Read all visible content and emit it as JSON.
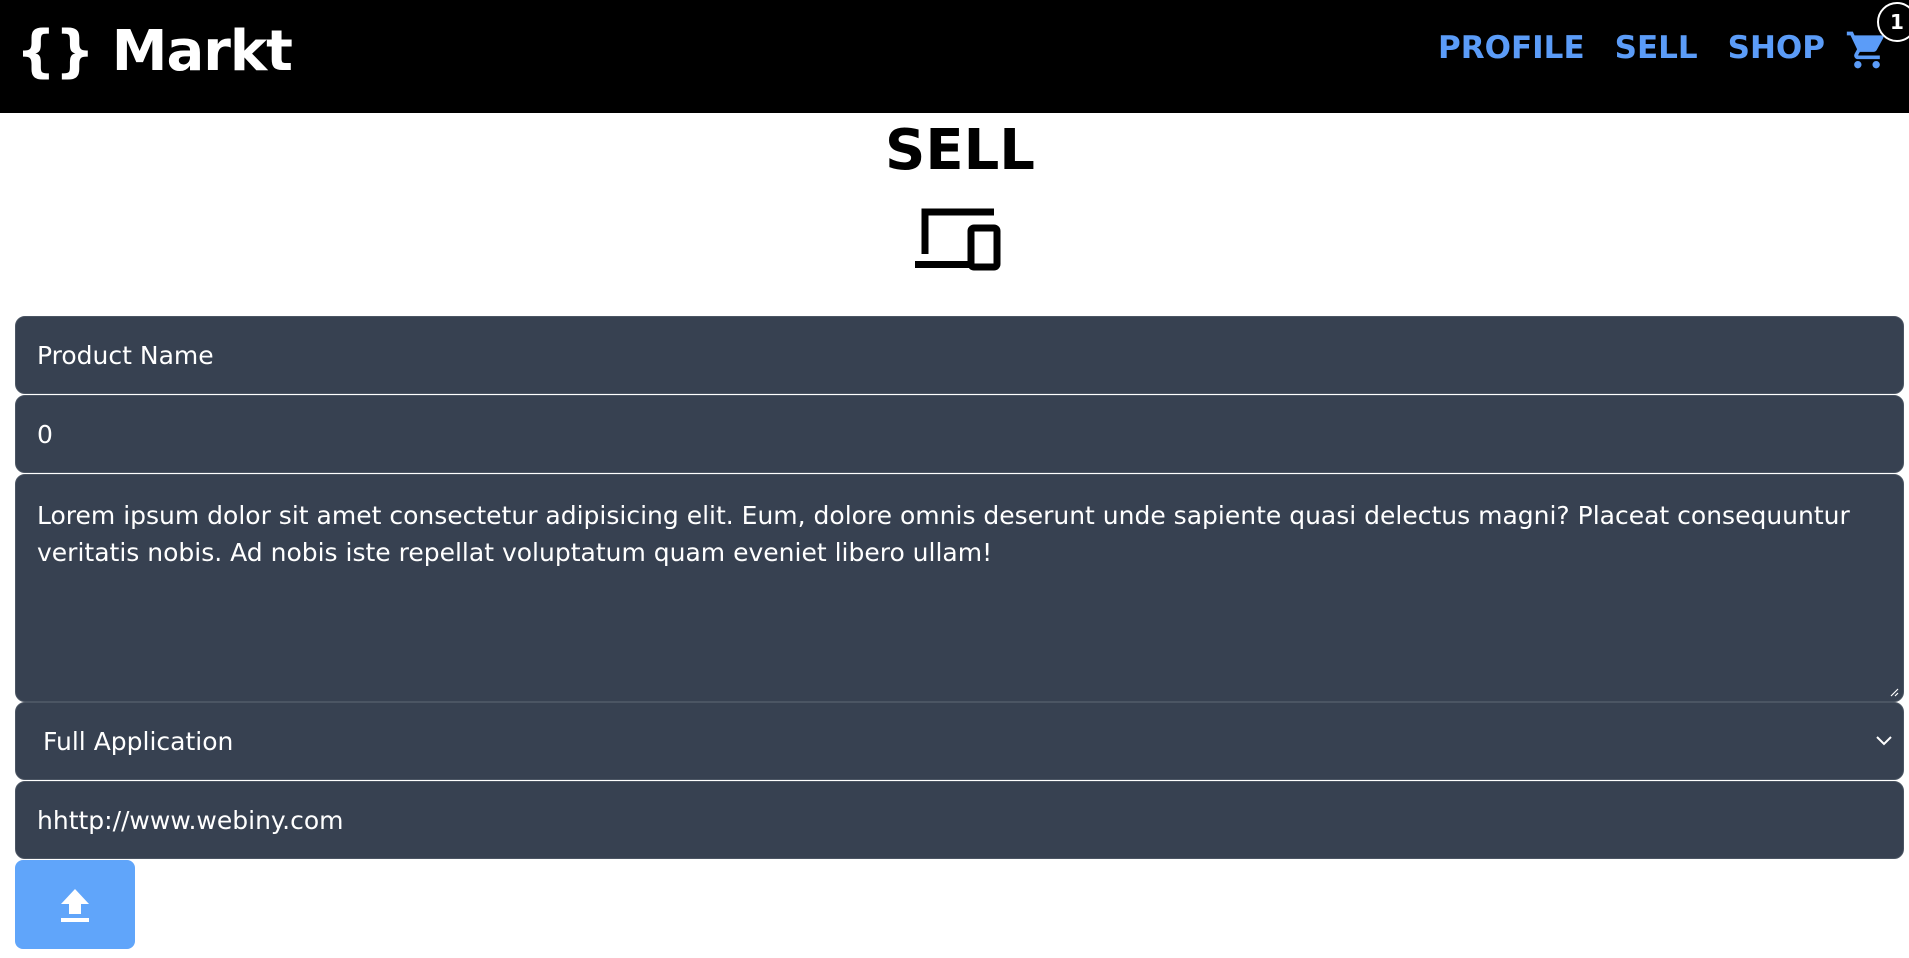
{
  "navbar": {
    "logo_braces": "{}",
    "logo_text": "Markt",
    "links": [
      "PROFILE",
      "SELL",
      "SHOP"
    ],
    "cart_icon": "cart-icon",
    "cart_count": "1"
  },
  "page": {
    "title": "SELL",
    "hero_icon": "devices-icon"
  },
  "form": {
    "product_name": "Product Name",
    "price": "0",
    "description": "Lorem ipsum dolor sit amet consectetur adipisicing elit. Eum, dolore omnis deserunt unde sapiente quasi delectus magni? Placeat consequuntur veritatis nobis. Ad nobis iste repellat voluptatum quam eveniet libero ullam!",
    "category_selected": "Full Application",
    "url": "hhttp://www.webiny.com",
    "upload_icon": "upload-icon"
  },
  "colors": {
    "navbar_bg": "#000000",
    "nav_link": "#5b9cf8",
    "field_bg": "#374151",
    "upload_button": "#60a5fa"
  }
}
